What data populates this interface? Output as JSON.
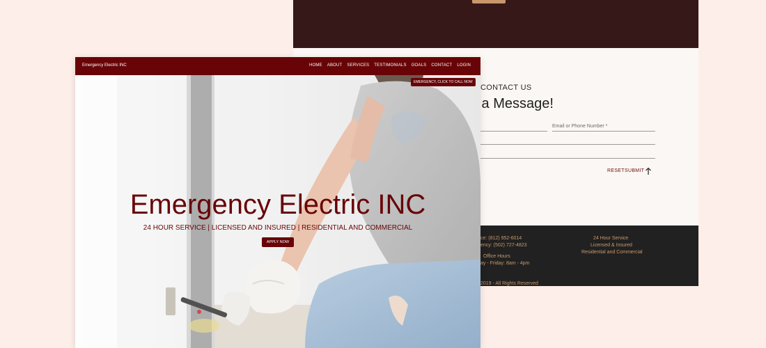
{
  "contact_page": {
    "eyebrow": "CONTACT US",
    "heading": "s a Message!",
    "email_label": "Email or Phone Number *",
    "reset_label": "RESET",
    "submit_label": "SUBMIT",
    "footer": {
      "office_phone": "ce: (812) 952-6014",
      "emergency_phone": "ency: (502) 727-4823",
      "hours_title": "Office Hours",
      "hours_value": "ay - Friday: 8am - 4pm",
      "copyright": "2019 - All Rights Reserved",
      "services": [
        "24 Hour Service",
        "Licensed & Insured",
        "Residential and Commercial"
      ]
    }
  },
  "home_page": {
    "brand": "Emergency Electric INC",
    "nav": [
      "HOME",
      "ABOUT",
      "SERVICES",
      "TESTIMONIALS",
      "GOALS",
      "CONTACT",
      "LOGIN"
    ],
    "emergency_button": "EMERGENCY, CLICK TO CALL NOW",
    "hero_title": "Emergency Electric INC",
    "hero_subtitle": "24 HOUR SERVICE | LICENSED AND INSURED | RESIDENTIAL AND COMMERCIAL",
    "apply_button": "APPLY NOW"
  },
  "colors": {
    "brand_red": "#680407",
    "page_background": "#fdeee9",
    "footer_dark": "#222121",
    "footer_accent": "#c59a6e",
    "band_dark": "#371819"
  },
  "icons": {
    "scroll_top": "arrow-up-icon"
  }
}
